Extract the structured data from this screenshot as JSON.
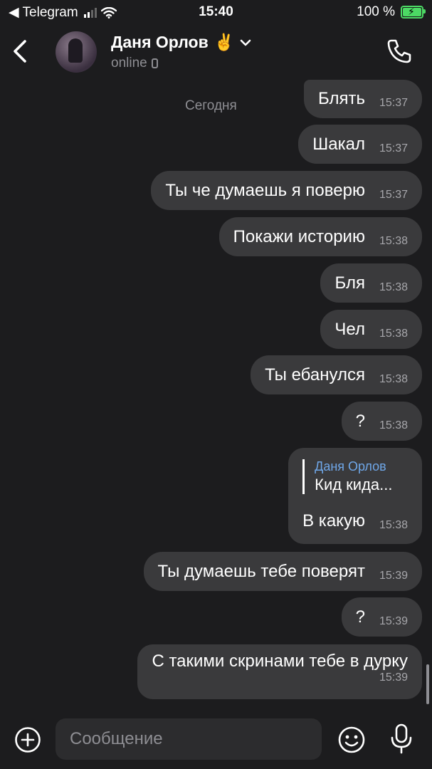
{
  "status_bar": {
    "back_app": "◀ Telegram",
    "time": "15:40",
    "battery": "100 %"
  },
  "header": {
    "name": "Даня Орлов",
    "name_emoji": "✌️",
    "status": "online"
  },
  "date_label": "Сегодня",
  "messages": [
    {
      "text": "Блять",
      "time": "15:37"
    },
    {
      "text": "Шакал",
      "time": "15:37"
    },
    {
      "text": "Ты че думаешь я поверю",
      "time": "15:37"
    },
    {
      "text": "Покажи историю",
      "time": "15:38"
    },
    {
      "text": "Бля",
      "time": "15:38"
    },
    {
      "text": "Чел",
      "time": "15:38"
    },
    {
      "text": "Ты ебанулся",
      "time": "15:38"
    },
    {
      "text": "?",
      "time": "15:38"
    },
    {
      "reply_name": "Даня Орлов",
      "reply_text": "Кид кида...",
      "text": "В какую",
      "time": "15:38"
    },
    {
      "text": "Ты думаешь тебе поверят",
      "time": "15:39"
    },
    {
      "text": "?",
      "time": "15:39"
    },
    {
      "text": "С такими скринами тебе в дурку",
      "time": "15:39"
    }
  ],
  "input": {
    "placeholder": "Сообщение"
  },
  "icons": {
    "back": "chevron-left-icon",
    "call": "phone-icon",
    "attach": "plus-circle-icon",
    "emoji": "smile-icon",
    "mic": "microphone-icon"
  },
  "colors": {
    "background": "#1c1c1e",
    "bubble": "#3a3a3c",
    "reply_accent": "#6fa7e8",
    "battery": "#4cd964"
  }
}
